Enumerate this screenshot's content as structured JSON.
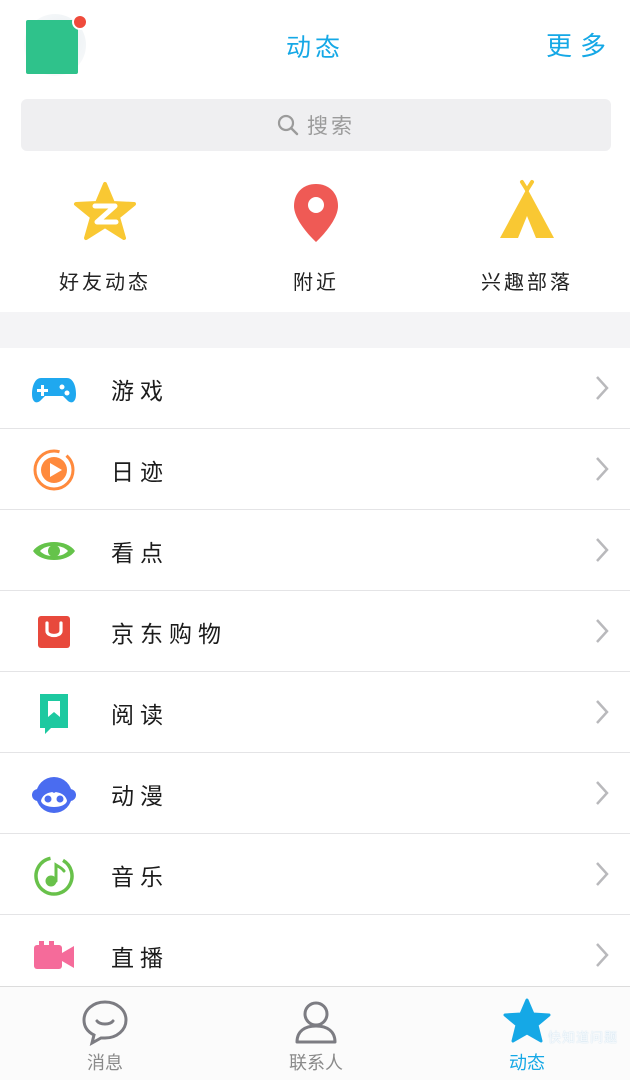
{
  "header": {
    "title": "动态",
    "more_label": "更多",
    "colors": {
      "accent": "#15a8e6",
      "avatar": "#2fc28b",
      "badge": "#ef4b3c"
    }
  },
  "search": {
    "placeholder": "搜索",
    "icon": "search-icon"
  },
  "quick_entries": [
    {
      "label": "好友动态",
      "icon": "qzone-star-icon",
      "color": "#f9c833"
    },
    {
      "label": "附近",
      "icon": "location-pin-icon",
      "color": "#ef5a55"
    },
    {
      "label": "兴趣部落",
      "icon": "tent-icon",
      "color": "#f9c833"
    }
  ],
  "list": [
    {
      "label": "游戏",
      "icon": "gamepad-icon",
      "color": "#1fa8ef"
    },
    {
      "label": "日迹",
      "icon": "video-play-icon",
      "color": "#ff8a3d"
    },
    {
      "label": "看点",
      "icon": "eye-icon",
      "color": "#65c34a"
    },
    {
      "label": "京东购物",
      "icon": "shopping-bag-icon",
      "color": "#e8493c"
    },
    {
      "label": "阅读",
      "icon": "bookmark-icon",
      "color": "#1dc9a0"
    },
    {
      "label": "动漫",
      "icon": "anime-face-icon",
      "color": "#4a6cf0"
    },
    {
      "label": "音乐",
      "icon": "music-icon",
      "color": "#68c14a"
    },
    {
      "label": "直播",
      "icon": "camera-icon",
      "color": "#f56b9a"
    }
  ],
  "tabs": [
    {
      "label": "消息",
      "icon": "chat-bubble-icon",
      "active": false
    },
    {
      "label": "联系人",
      "icon": "contact-person-icon",
      "active": false
    },
    {
      "label": "动态",
      "icon": "star-icon",
      "active": true
    }
  ],
  "watermark": "快知道问题"
}
